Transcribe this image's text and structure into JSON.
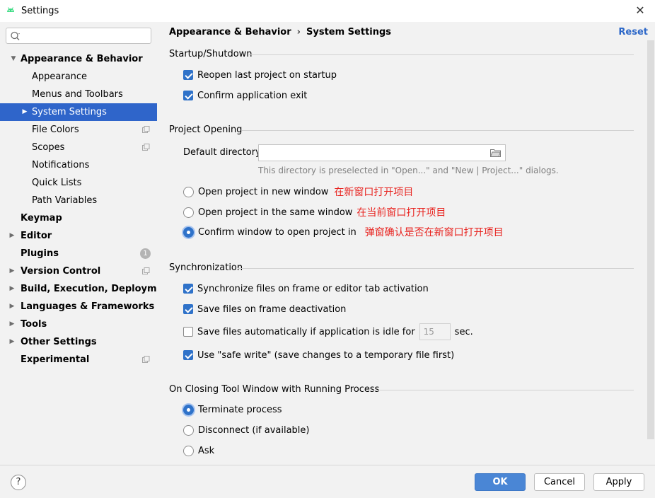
{
  "window": {
    "title": "Settings",
    "close_glyph": "✕"
  },
  "sidebar": {
    "search_placeholder": "",
    "items": [
      {
        "label": "Appearance & Behavior",
        "bold": true,
        "arrow": "▼"
      },
      {
        "label": "Appearance"
      },
      {
        "label": "Menus and Toolbars"
      },
      {
        "label": "System Settings",
        "selected": true,
        "arrow": "▶"
      },
      {
        "label": "File Colors"
      },
      {
        "label": "Scopes"
      },
      {
        "label": "Notifications"
      },
      {
        "label": "Quick Lists"
      },
      {
        "label": "Path Variables"
      },
      {
        "label": "Keymap",
        "bold": true
      },
      {
        "label": "Editor",
        "bold": true,
        "arrow": "▶"
      },
      {
        "label": "Plugins",
        "bold": true,
        "badge": "1"
      },
      {
        "label": "Version Control",
        "bold": true,
        "arrow": "▶"
      },
      {
        "label": "Build, Execution, Deployment",
        "bold": true,
        "arrow": "▶"
      },
      {
        "label": "Languages & Frameworks",
        "bold": true,
        "arrow": "▶"
      },
      {
        "label": "Tools",
        "bold": true,
        "arrow": "▶"
      },
      {
        "label": "Other Settings",
        "bold": true,
        "arrow": "▶"
      },
      {
        "label": "Experimental",
        "bold": true
      }
    ]
  },
  "header": {
    "crumb_parent": "Appearance & Behavior",
    "crumb_sep": "›",
    "crumb_current": "System Settings",
    "reset_label": "Reset"
  },
  "startup": {
    "title": "Startup/Shutdown",
    "reopen_label": "Reopen last project on startup",
    "confirm_exit_label": "Confirm application exit"
  },
  "project_opening": {
    "title": "Project Opening",
    "default_dir_label": "Default directory:",
    "default_dir_value": "",
    "hint": "This directory is preselected in \"Open...\" and \"New | Project...\" dialogs.",
    "new_window_label": "Open project in new window",
    "new_window_note": "在新窗口打开项目",
    "same_window_label": "Open project in the same window",
    "same_window_note": "在当前窗口打开项目",
    "confirm_label": "Confirm window to open project in",
    "confirm_note": "弹窗确认是否在新窗口打开项目"
  },
  "sync": {
    "title": "Synchronization",
    "sync_files_label": "Synchronize files on frame or editor tab activation",
    "save_deactivation_label": "Save files on frame deactivation",
    "save_idle_label": "Save files automatically if application is idle for",
    "idle_value": "15",
    "idle_unit": "sec.",
    "safe_write_label": "Use \"safe write\" (save changes to a temporary file first)"
  },
  "closing": {
    "title": "On Closing Tool Window with Running Process",
    "terminate_label": "Terminate process",
    "disconnect_label": "Disconnect (if available)",
    "ask_label": "Ask"
  },
  "footer": {
    "help_glyph": "?",
    "ok_label": "OK",
    "cancel_label": "Cancel",
    "apply_label": "Apply"
  },
  "colors": {
    "selection": "#2f65ca",
    "accent": "#2f72c9",
    "link": "#2c67c8",
    "annotation": "#e8231f"
  }
}
